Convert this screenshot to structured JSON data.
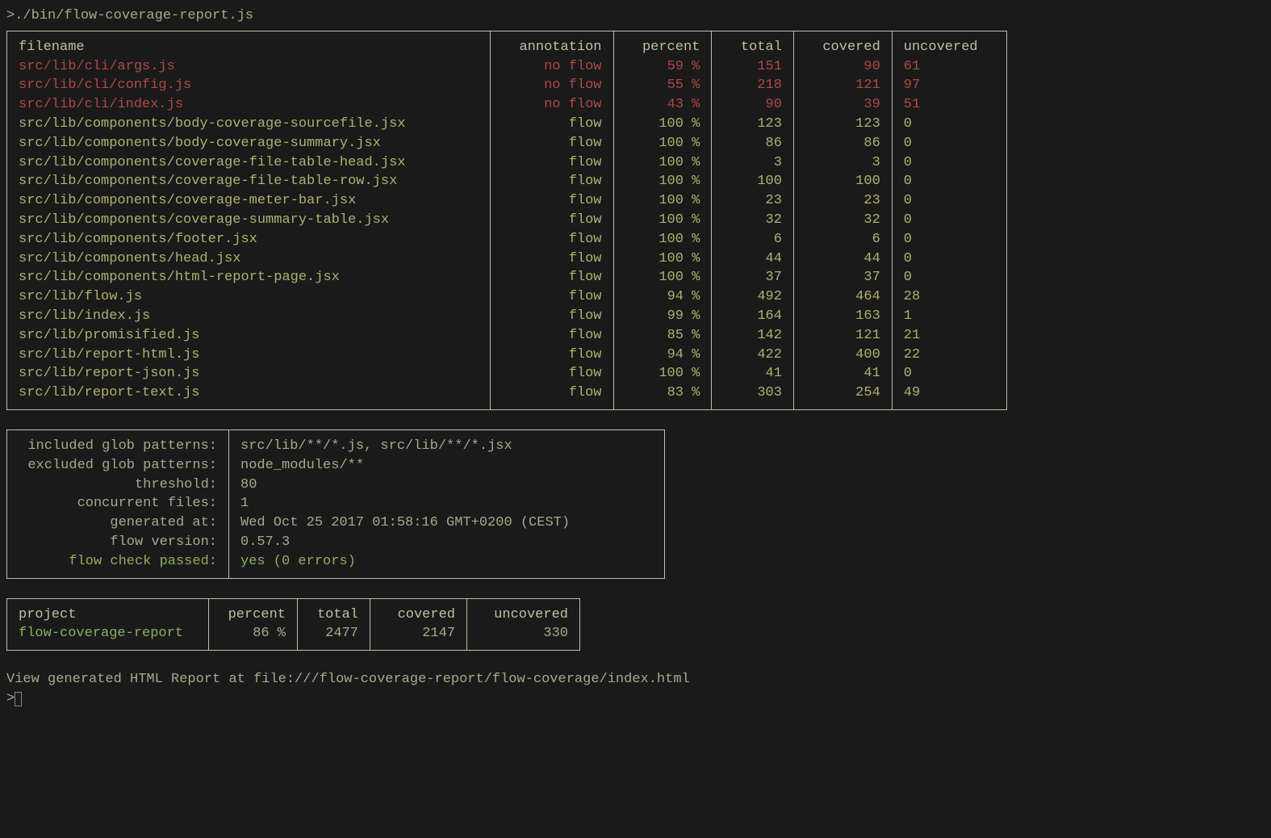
{
  "prompt": ">./bin/flow-coverage-report.js",
  "files_table": {
    "headers": [
      "filename",
      "annotation",
      "percent",
      "total",
      "covered",
      "uncovered"
    ],
    "rows": [
      {
        "filename": "src/lib/cli/args.js",
        "annotation": "no flow",
        "percent": "59 %",
        "total": "151",
        "covered": "90",
        "uncovered": "61",
        "noflow": true
      },
      {
        "filename": "src/lib/cli/config.js",
        "annotation": "no flow",
        "percent": "55 %",
        "total": "218",
        "covered": "121",
        "uncovered": "97",
        "noflow": true
      },
      {
        "filename": "src/lib/cli/index.js",
        "annotation": "no flow",
        "percent": "43 %",
        "total": "90",
        "covered": "39",
        "uncovered": "51",
        "noflow": true
      },
      {
        "filename": "src/lib/components/body-coverage-sourcefile.jsx",
        "annotation": "flow",
        "percent": "100 %",
        "total": "123",
        "covered": "123",
        "uncovered": "0",
        "noflow": false
      },
      {
        "filename": "src/lib/components/body-coverage-summary.jsx",
        "annotation": "flow",
        "percent": "100 %",
        "total": "86",
        "covered": "86",
        "uncovered": "0",
        "noflow": false
      },
      {
        "filename": "src/lib/components/coverage-file-table-head.jsx",
        "annotation": "flow",
        "percent": "100 %",
        "total": "3",
        "covered": "3",
        "uncovered": "0",
        "noflow": false
      },
      {
        "filename": "src/lib/components/coverage-file-table-row.jsx",
        "annotation": "flow",
        "percent": "100 %",
        "total": "100",
        "covered": "100",
        "uncovered": "0",
        "noflow": false
      },
      {
        "filename": "src/lib/components/coverage-meter-bar.jsx",
        "annotation": "flow",
        "percent": "100 %",
        "total": "23",
        "covered": "23",
        "uncovered": "0",
        "noflow": false
      },
      {
        "filename": "src/lib/components/coverage-summary-table.jsx",
        "annotation": "flow",
        "percent": "100 %",
        "total": "32",
        "covered": "32",
        "uncovered": "0",
        "noflow": false
      },
      {
        "filename": "src/lib/components/footer.jsx",
        "annotation": "flow",
        "percent": "100 %",
        "total": "6",
        "covered": "6",
        "uncovered": "0",
        "noflow": false
      },
      {
        "filename": "src/lib/components/head.jsx",
        "annotation": "flow",
        "percent": "100 %",
        "total": "44",
        "covered": "44",
        "uncovered": "0",
        "noflow": false
      },
      {
        "filename": "src/lib/components/html-report-page.jsx",
        "annotation": "flow",
        "percent": "100 %",
        "total": "37",
        "covered": "37",
        "uncovered": "0",
        "noflow": false
      },
      {
        "filename": "src/lib/flow.js",
        "annotation": "flow",
        "percent": "94 %",
        "total": "492",
        "covered": "464",
        "uncovered": "28",
        "noflow": false
      },
      {
        "filename": "src/lib/index.js",
        "annotation": "flow",
        "percent": "99 %",
        "total": "164",
        "covered": "163",
        "uncovered": "1",
        "noflow": false
      },
      {
        "filename": "src/lib/promisified.js",
        "annotation": "flow",
        "percent": "85 %",
        "total": "142",
        "covered": "121",
        "uncovered": "21",
        "noflow": false
      },
      {
        "filename": "src/lib/report-html.js",
        "annotation": "flow",
        "percent": "94 %",
        "total": "422",
        "covered": "400",
        "uncovered": "22",
        "noflow": false
      },
      {
        "filename": "src/lib/report-json.js",
        "annotation": "flow",
        "percent": "100 %",
        "total": "41",
        "covered": "41",
        "uncovered": "0",
        "noflow": false
      },
      {
        "filename": "src/lib/report-text.js",
        "annotation": "flow",
        "percent": "83 %",
        "total": "303",
        "covered": "254",
        "uncovered": "49",
        "noflow": false
      }
    ]
  },
  "meta": {
    "labels": {
      "included": "included glob patterns:",
      "excluded": "excluded glob patterns:",
      "threshold": "threshold:",
      "concurrent": "concurrent files:",
      "generated": "generated at:",
      "flowver": "flow version:",
      "check": "flow check passed:"
    },
    "values": {
      "included": "src/lib/**/*.js, src/lib/**/*.jsx",
      "excluded": "node_modules/**",
      "threshold": "80",
      "concurrent": "1",
      "generated": "Wed Oct 25 2017 01:58:16 GMT+0200 (CEST)",
      "flowver": "0.57.3",
      "check": "yes (0 errors)"
    }
  },
  "summary": {
    "headers": [
      "project",
      "percent",
      "total",
      "covered",
      "uncovered"
    ],
    "row": {
      "project": "flow-coverage-report",
      "percent": "86 %",
      "total": "2477",
      "covered": "2147",
      "uncovered": "330"
    }
  },
  "footer": "View generated HTML Report at file:///flow-coverage-report/flow-coverage/index.html",
  "final_prompt": ">"
}
